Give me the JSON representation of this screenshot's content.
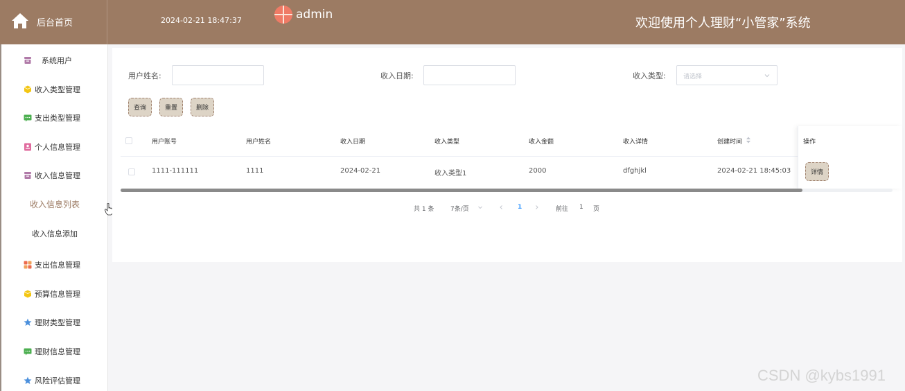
{
  "header": {
    "home_label": "后台首页",
    "datetime": "2024-02-21 18:47:37",
    "username": "admin",
    "welcome": "欢迎使用个人理财“小管家”系统",
    "background_color": "#9c7b63"
  },
  "sidebar": {
    "items": [
      {
        "label": "系统用户",
        "icon": "archive-icon",
        "color": "#b07aa8"
      },
      {
        "label": "收入类型管理",
        "icon": "cube-icon",
        "color": "#f3c613"
      },
      {
        "label": "支出类型管理",
        "icon": "chat-icon",
        "color": "#4caf50"
      },
      {
        "label": "个人信息管理",
        "icon": "id-card-icon",
        "color": "#e06b9e"
      },
      {
        "label": "收入信息管理",
        "icon": "archive-icon",
        "color": "#b07aa8"
      },
      {
        "label": "支出信息管理",
        "icon": "grid-icon",
        "color": "#ec6a4c"
      },
      {
        "label": "预算信息管理",
        "icon": "cube-icon",
        "color": "#f3c613"
      },
      {
        "label": "理财类型管理",
        "icon": "star-icon",
        "color": "#4a8fdc"
      },
      {
        "label": "理财信息管理",
        "icon": "chat-icon",
        "color": "#4caf50"
      },
      {
        "label": "风险评估管理",
        "icon": "star-icon",
        "color": "#4a8fdc"
      }
    ],
    "submenu": [
      {
        "label": "收入信息列表",
        "active": true
      },
      {
        "label": "收入信息添加",
        "active": false
      }
    ]
  },
  "search": {
    "username_label": "用户姓名:",
    "date_label": "收入日期:",
    "type_label": "收入类型:",
    "type_placeholder": "请选择",
    "username_value": "",
    "date_value": ""
  },
  "buttons": {
    "query": "查询",
    "reset": "重置",
    "delete": "删除"
  },
  "table": {
    "columns": [
      "用户账号",
      "用户姓名",
      "收入日期",
      "收入类型",
      "收入金额",
      "收入详情",
      "创建时间",
      "操作"
    ],
    "rows": [
      {
        "account": "1111-111111",
        "name": "1111",
        "date": "2024-02-21",
        "type": "收入类型1",
        "amount": "2000",
        "detail": "dfghjkl",
        "created": "2024-02-21 18:45:03",
        "action": "详情"
      }
    ]
  },
  "pagination": {
    "total": "共 1 条",
    "page_size": "7条/页",
    "current_page": "1",
    "goto_label": "前往",
    "goto_value": "1",
    "page_suffix": "页",
    "active_color": "#409eff"
  },
  "watermark": "CSDN @kybs1991"
}
